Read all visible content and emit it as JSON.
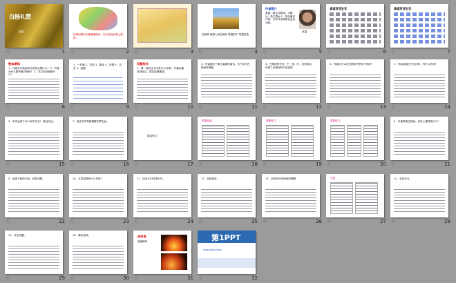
{
  "slides": [
    {
      "n": "1",
      "kind": "cover",
      "title": "白杨礼赞",
      "sub": "茅盾"
    },
    {
      "n": "2",
      "kind": "map",
      "text": "白杨树是北方最普通的树，生长在西北黄土高原。"
    },
    {
      "n": "3",
      "kind": "map2"
    },
    {
      "n": "4",
      "kind": "photo",
      "caption": "白杨林 高原上的白杨树 笔直的干 笔直的枝"
    },
    {
      "n": "5",
      "kind": "author",
      "title": "作者简介",
      "text": "茅盾，原名沈德鸿，字雁冰，浙江桐乡人，现代著名作家、文学评论家和社会活动家。",
      "name": "茅盾"
    },
    {
      "n": "6",
      "kind": "words",
      "title": "读读写写生字"
    },
    {
      "n": "7",
      "kind": "words2",
      "title": "读读写写生字"
    },
    {
      "n": "8",
      "kind": "text",
      "title": "整体感知",
      "text": "1．作者写白杨树的外形特点是什么？ 2．作者为什么要赞美白杨树？ 3．本文的线索是什么？"
    },
    {
      "n": "9",
      "kind": "list",
      "text": "1．一开篇 2．衬托 3．象征 4．抒情 5．议论 6．结尾"
    },
    {
      "n": "10",
      "kind": "text",
      "title": "问题探究",
      "text": "1．第一段在全文中有什么作用？ 开篇点题，总领全文，奠定感情基调。"
    },
    {
      "n": "11",
      "kind": "text",
      "title": "",
      "text": "2．作者描写了黄土高原的景色，为下文写白杨树作铺垫。"
    },
    {
      "n": "12",
      "kind": "text",
      "title": "",
      "text": "3．白杨树的外形：干、枝、叶、皮的特点，体现了白杨树的内在品质。"
    },
    {
      "n": "13",
      "kind": "text",
      "title": "",
      "text": "4．作者为什么说白杨树不是平凡的树？"
    },
    {
      "n": "14",
      "kind": "text",
      "title": "",
      "text": "5．作者连用四个反问句，有什么作用？"
    },
    {
      "n": "15",
      "kind": "text",
      "title": "",
      "text": "6．本文运用了什么写作手法？ 象征手法。"
    },
    {
      "n": "16",
      "kind": "text",
      "title": "",
      "text": "7．结合写作背景理解文章主旨。"
    },
    {
      "n": "17",
      "kind": "blank",
      "text": "课后练习"
    },
    {
      "n": "18",
      "kind": "boxes",
      "text": "拓展阅读"
    },
    {
      "n": "19",
      "kind": "boxes",
      "text": "课堂练习"
    },
    {
      "n": "20",
      "kind": "boxes2",
      "text": "课堂练习"
    },
    {
      "n": "21",
      "kind": "text",
      "title": "",
      "text": "8．作者赞美白杨树，实际上是赞美什么？"
    },
    {
      "n": "22",
      "kind": "text",
      "title": "",
      "text": "9．阅读下面的文段，回答问题。"
    },
    {
      "n": "23",
      "kind": "text",
      "title": "",
      "text": "10．文章结尾有什么作用？"
    },
    {
      "n": "24",
      "kind": "text",
      "title": "",
      "text": "11．找出文中的排比句。"
    },
    {
      "n": "25",
      "kind": "text",
      "title": "",
      "text": "12．品味语言。"
    },
    {
      "n": "26",
      "kind": "text",
      "title": "",
      "text": "13．说说你对白杨树的理解。"
    },
    {
      "n": "27",
      "kind": "boxes",
      "text": "小结"
    },
    {
      "n": "28",
      "kind": "text",
      "title": "",
      "text": "14．总结全文。"
    },
    {
      "n": "29",
      "kind": "text",
      "title": "",
      "text": "15．作业布置。"
    },
    {
      "n": "30",
      "kind": "text",
      "title": "",
      "text": "16．课外延伸。"
    },
    {
      "n": "31",
      "kind": "photo2",
      "title": "结束语",
      "text": "感谢聆听"
    },
    {
      "n": "32",
      "kind": "brand",
      "brand": "第1PPT",
      "text": "www.1ppt.com"
    }
  ]
}
